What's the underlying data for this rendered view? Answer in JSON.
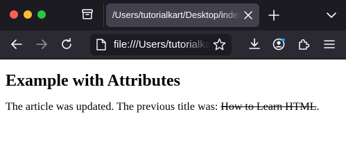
{
  "browser": {
    "tab": {
      "title": "/Users/tutorialkart/Desktop/index.html"
    },
    "address_bar": {
      "url": "file:///Users/tutorialkart/Desktop/index.html"
    }
  },
  "page": {
    "heading": "Example with Attributes",
    "paragraph_text": "The article was updated. The previous title was: ",
    "deleted_text": "How to Learn HTML",
    "paragraph_end": "."
  }
}
